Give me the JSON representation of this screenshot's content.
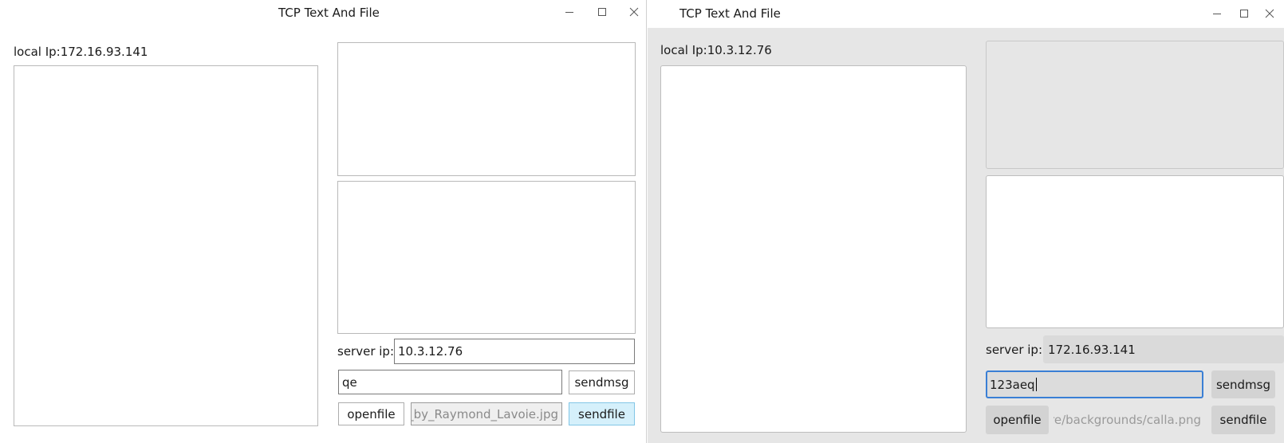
{
  "left_window": {
    "title": "TCP Text And File",
    "local_ip_label": "local Ip:172.16.93.141",
    "server_ip_label": "server ip:",
    "server_ip_value": "10.3.12.76",
    "message_value": "qe",
    "sendmsg_label": "sendmsg",
    "openfile_label": "openfile",
    "file_path_value": "s_by_Raymond_Lavoie.jpg",
    "sendfile_label": "sendfile"
  },
  "right_window": {
    "title": "TCP Text And File",
    "local_ip_label": "local Ip:10.3.12.76",
    "server_ip_label": "server ip:",
    "server_ip_value": "172.16.93.141",
    "message_value": "123aeq",
    "sendmsg_label": "sendmsg",
    "openfile_label": "openfile",
    "file_path_value": "re/backgrounds/calla.png",
    "sendfile_label": "sendfile"
  },
  "icons": {
    "minimize": "minimize-icon",
    "maximize": "maximize-icon",
    "close": "close-icon"
  }
}
